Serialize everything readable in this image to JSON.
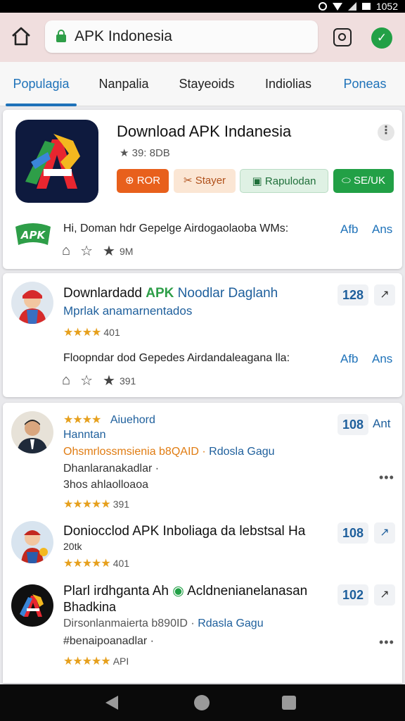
{
  "status_bar": {
    "time": "1052"
  },
  "browser": {
    "url": "APK Indonesia"
  },
  "tabs": [
    {
      "label": "Populagia",
      "active": true
    },
    {
      "label": "Nanpalia"
    },
    {
      "label": "Stayeoids"
    },
    {
      "label": "Indiolias"
    },
    {
      "label": "Poneas"
    }
  ],
  "featured": {
    "title": "Download APK Indanesia",
    "rating": "★ 39: 8DB",
    "buttons": {
      "b1": "ROR",
      "b2": "Stayer",
      "b3": "Rapulodan",
      "b4": "SE/UK"
    },
    "description": "Hi, Doman hdr Gepelge Airdogaolaoba WMs:",
    "tag1": "Afb",
    "tag2": "Ans",
    "download_count": "9M",
    "apk_badge": "APK"
  },
  "second": {
    "title": "Downlardadd",
    "title_apk": "APK",
    "title_rest": "Noodlar Daglanh",
    "subtitle": "Mprlak anamarnentados",
    "stars": "★★★★",
    "rating_num": "401",
    "count": "128",
    "share": "↗",
    "description": "Floopndar dod Gepedes Airdandaleagana lla:",
    "tag1": "Afb",
    "tag2": "Ans",
    "download_count": "391"
  },
  "list": [
    {
      "top_stars": "★★★★",
      "top_label": "Aiuehord",
      "name": "Hanntan",
      "meta1_orange": "Ohsmrlossmsienia b8QAID",
      "meta1_blue": "Rdosla Gagu",
      "meta2": "Dhanlaranakadlar ·",
      "meta3": "3hos ahlaolloaoa",
      "stars": "★★★★★",
      "rating_num": "391",
      "count": "108",
      "side_label": "Ant"
    },
    {
      "title": "Doniocclod APK Inboliaga da lebstsal Ha",
      "sub": "20tk",
      "stars": "★★★★★",
      "rating_num": "401",
      "count": "108",
      "share": "↗"
    },
    {
      "title": "Plarl irdhganta Ah",
      "title_rest": "Acldnenianelanasan",
      "sub": "Bhadkina",
      "meta1": "Dirsonlanmaierta b890ID",
      "meta1_blue": "Rdasla Gagu",
      "meta2": "#benaipoanadlar ·",
      "stars": "★★★★★",
      "rating_num": "API",
      "count": "102",
      "share": "↗"
    }
  ],
  "colors": {
    "accent": "#1e72b9",
    "orange": "#e8601c",
    "green": "#22a046",
    "star": "#e6a01d"
  }
}
